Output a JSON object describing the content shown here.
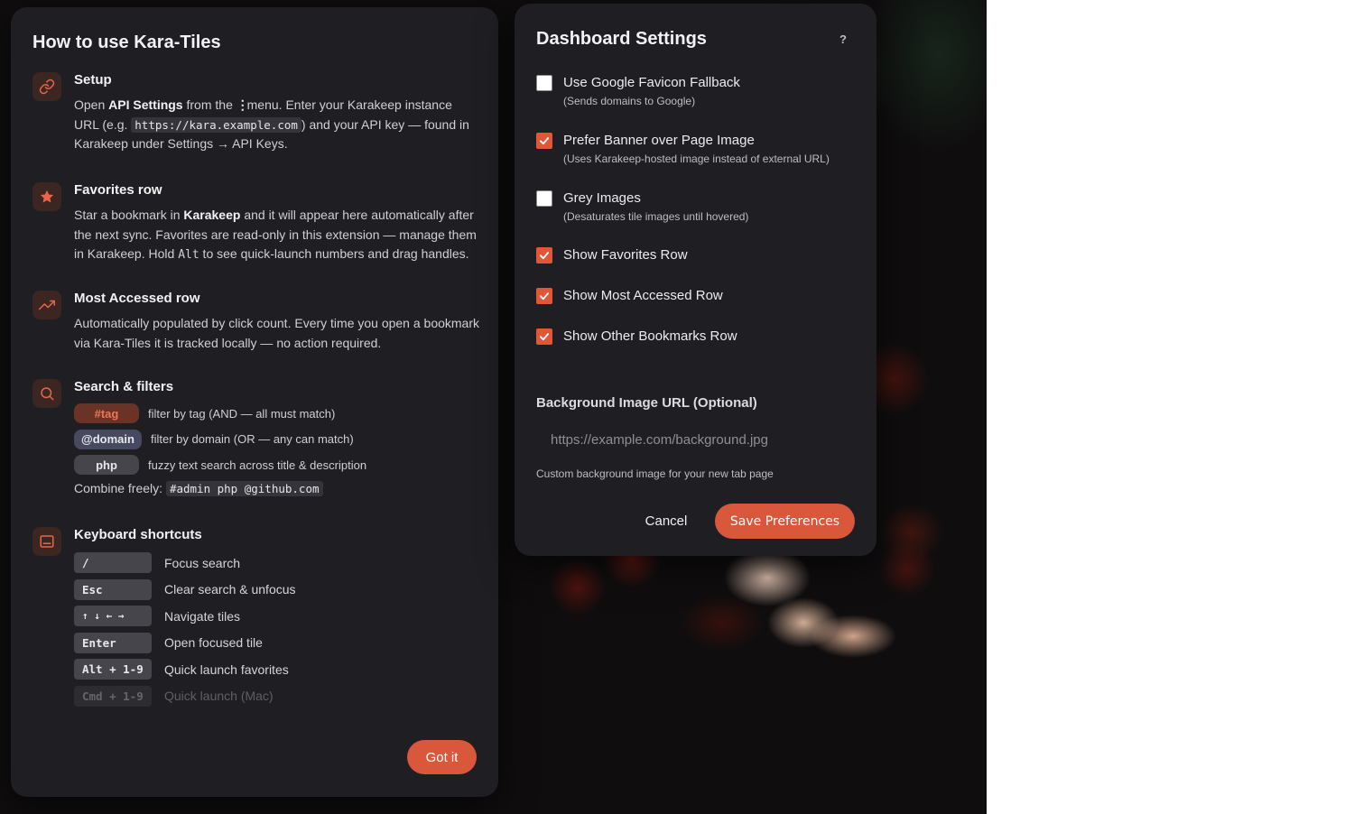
{
  "help": {
    "title": "How to use Kara-Tiles",
    "setup": {
      "title": "Setup",
      "t1": "Open ",
      "api_settings": "API Settings",
      "t2": " from the ",
      "t3": " menu. Enter your Karakeep instance URL (e.g. ",
      "example_url": "https://kara.example.com",
      "t4": ") and your API key — found in Karakeep under Settings → API Keys."
    },
    "favorites": {
      "title": "Favorites row",
      "t1": "Star a bookmark in ",
      "karakeep": "Karakeep",
      "t2": " and it will appear here automatically after the next sync. Favorites are read-only in this extension — manage them in Karakeep. Hold ",
      "alt": "Alt",
      "t3": " to see quick-launch numbers and drag handles."
    },
    "most_accessed": {
      "title": "Most Accessed row",
      "text": "Automatically populated by click count. Every time you open a bookmark via Kara-Tiles it is tracked locally — no action required."
    },
    "search": {
      "title": "Search & filters",
      "filters": [
        {
          "pill": "#tag",
          "desc": "filter by tag (AND — all must match)"
        },
        {
          "pill": "@domain",
          "desc": "filter by domain (OR — any can match)"
        },
        {
          "pill": "php",
          "desc": "fuzzy text search across title & description"
        }
      ],
      "combine_label": "Combine freely:",
      "combine_example": "#admin php @github.com"
    },
    "keyboard": {
      "title": "Keyboard shortcuts",
      "shortcuts": [
        {
          "key": "/",
          "desc": "Focus search"
        },
        {
          "key": "Esc",
          "desc": "Clear search & unfocus"
        },
        {
          "key": "↑ ↓ ← →",
          "desc": "Navigate tiles"
        },
        {
          "key": "Enter",
          "desc": "Open focused tile"
        },
        {
          "key": "Alt + 1-9",
          "desc": "Quick launch favorites"
        },
        {
          "key": "Cmd + 1-9",
          "desc": "Quick launch (Mac)"
        }
      ]
    },
    "got_it": "Got it"
  },
  "settings": {
    "title": "Dashboard Settings",
    "help_label": "?",
    "options": [
      {
        "label": "Use Google Favicon Fallback",
        "sub": "(Sends domains to Google)",
        "checked": false
      },
      {
        "label": "Prefer Banner over Page Image",
        "sub": "(Uses Karakeep-hosted image instead of external URL)",
        "checked": true
      },
      {
        "label": "Grey Images",
        "sub": "(Desaturates tile images until hovered)",
        "checked": false
      },
      {
        "label": "Show Favorites Row",
        "checked": true
      },
      {
        "label": "Show Most Accessed Row",
        "checked": true
      },
      {
        "label": "Show Other Bookmarks Row",
        "checked": true
      }
    ],
    "bg_label": "Background Image URL (Optional)",
    "bg_value": "",
    "bg_placeholder": "https://example.com/background.jpg",
    "bg_hint": "Custom background image for your new tab page",
    "cancel": "Cancel",
    "save": "Save Preferences"
  },
  "colors": {
    "accent": "#d9573a",
    "panel": "#1f1f23",
    "icon_bg": "#3b2622"
  },
  "icons": [
    "link-icon",
    "star-icon",
    "trending-up-icon",
    "search-icon",
    "keyboard-icon",
    "more-vertical-icon",
    "check-icon"
  ]
}
